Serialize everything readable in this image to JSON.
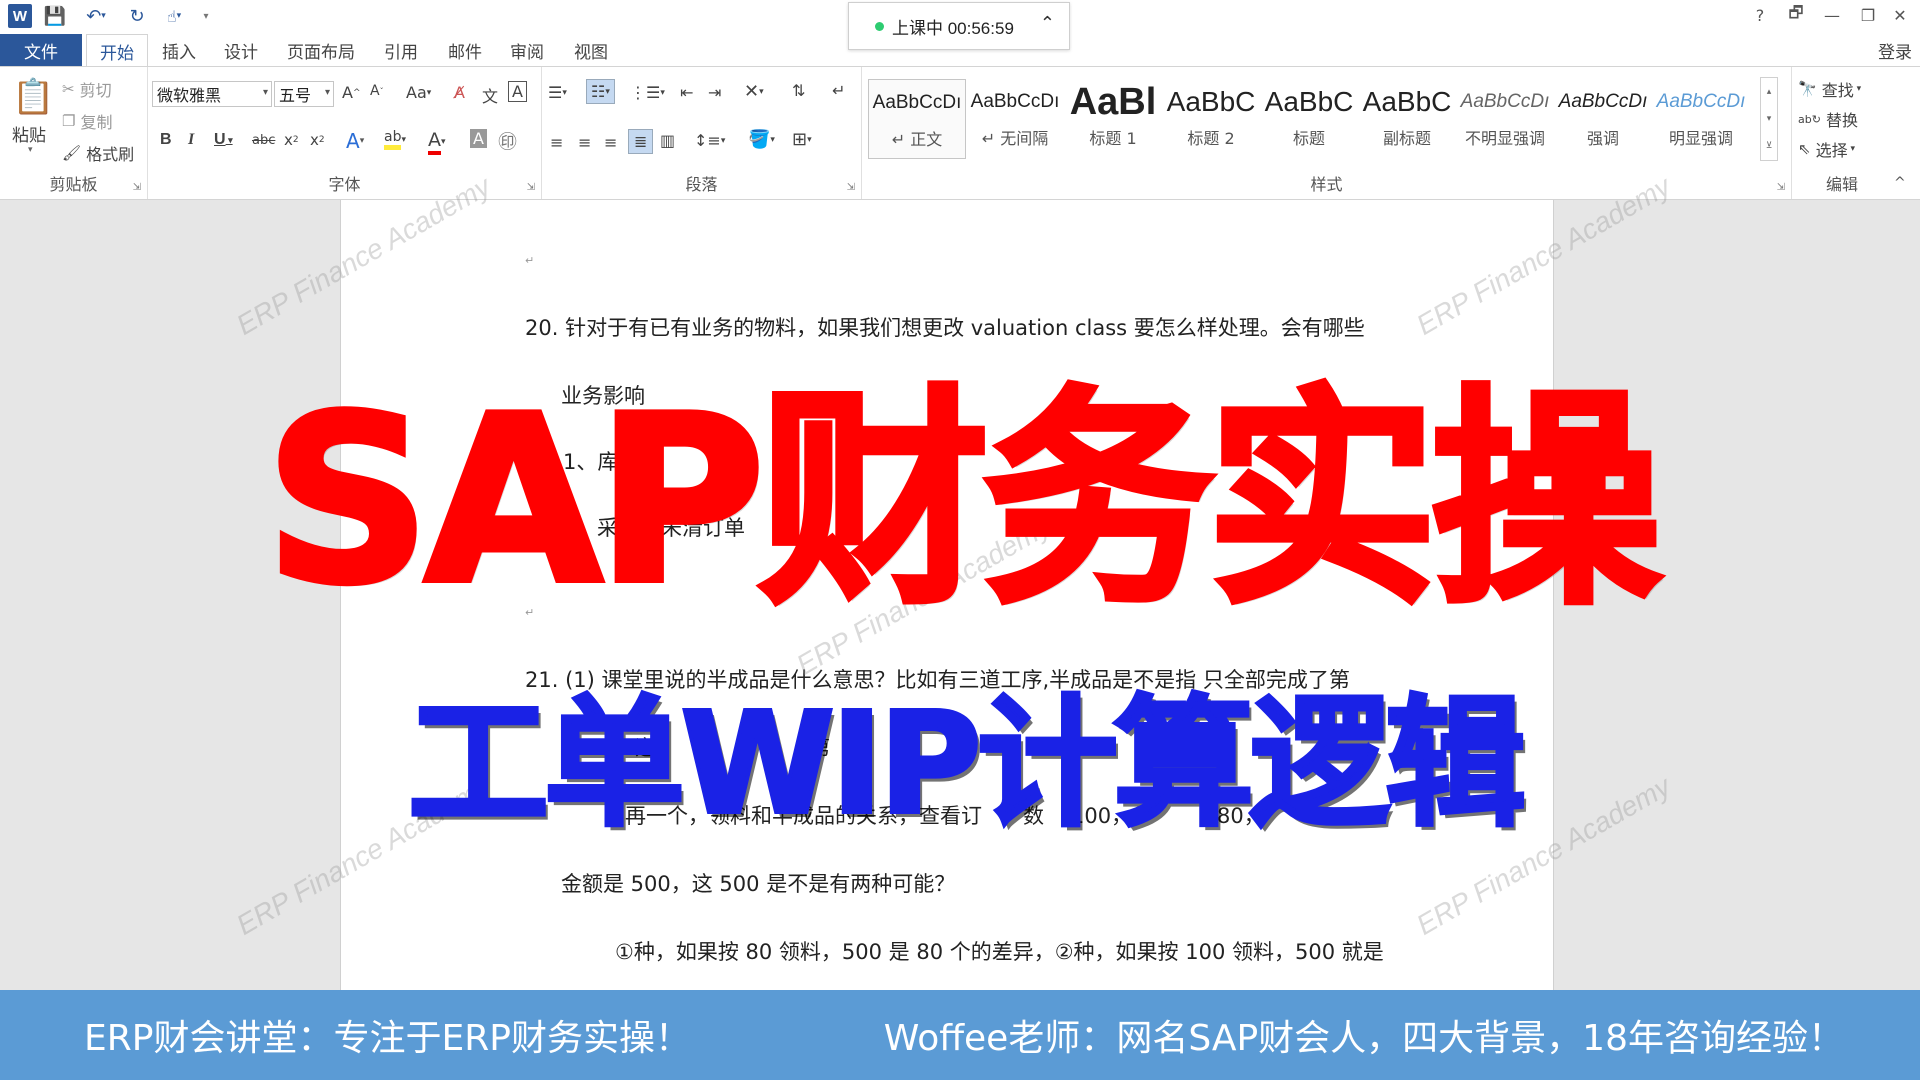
{
  "titlebar": {
    "help": "?",
    "restore_ribbon": "🗗",
    "minimize": "—",
    "maximize": "❐",
    "close": "✕"
  },
  "timer": {
    "label": "上课中 00:56:59"
  },
  "tabs": [
    {
      "label": "文件"
    },
    {
      "label": "开始"
    },
    {
      "label": "插入"
    },
    {
      "label": "设计"
    },
    {
      "label": "页面布局"
    },
    {
      "label": "引用"
    },
    {
      "label": "邮件"
    },
    {
      "label": "审阅"
    },
    {
      "label": "视图"
    }
  ],
  "login": "登录",
  "clipboard": {
    "paste": "粘贴",
    "cut": "剪切",
    "copy": "复制",
    "format_painter": "格式刷",
    "group_label": "剪贴板"
  },
  "font": {
    "family": "微软雅黑",
    "size": "五号",
    "group_label": "字体",
    "change_case": "Aa",
    "bold": "B",
    "italic": "I",
    "underline": "U",
    "strike": "abc"
  },
  "paragraph": {
    "group_label": "段落"
  },
  "styles": {
    "group_label": "样式",
    "items": [
      {
        "preview": "AaBbCcDı",
        "name": "↵ 正文"
      },
      {
        "preview": "AaBbCcDı",
        "name": "↵ 无间隔"
      },
      {
        "preview": "AaBl",
        "name": "标题 1"
      },
      {
        "preview": "AaBbC",
        "name": "标题 2"
      },
      {
        "preview": "AaBbC",
        "name": "标题"
      },
      {
        "preview": "AaBbC",
        "name": "副标题"
      },
      {
        "preview": "AaBbCcDı",
        "name": "不明显强调"
      },
      {
        "preview": "AaBbCcDı",
        "name": "强调"
      },
      {
        "preview": "AaBbCcDı",
        "name": "明显强调"
      }
    ]
  },
  "editing": {
    "find": "查找",
    "replace": "替换",
    "select": "选择",
    "group_label": "编辑"
  },
  "document": {
    "lines": [
      "20. 针对于有已有业务的物料，如果我们想更改 valuation  class  要怎么样处理。会有哪些",
      "业务影响",
      "1、库",
      "采",
      "未清订单",
      "21. (1)  课堂里说的半成品是什么意思？比如有三道工序,半成品是不是指 只全部完成了第",
      "道",
      "第",
      "再一个，领料和半成品的关系，查看订",
      "数",
      "100，",
      "80，",
      "金额是 500，这 500 是不是有两种可能？",
      "①种，如果按 80 领料，500 是 80 个的差异，②种，如果按 100 领料，500 就是"
    ]
  },
  "watermark": "ERP Finance Academy",
  "overlay": {
    "red": "SAP财务实操",
    "blue": "工单WIP计算逻辑"
  },
  "banner": {
    "left": "ERP财会讲堂：专注于ERP财务实操！",
    "right": "Woffee老师：网名SAP财会人，四大背景，18年咨询经验！"
  },
  "colors": {
    "word_blue": "#2b579a",
    "overlay_red": "#ff0000",
    "overlay_blue": "#1a22e6",
    "banner": "#5b9bd5",
    "timer_dot": "#2ecc71"
  }
}
